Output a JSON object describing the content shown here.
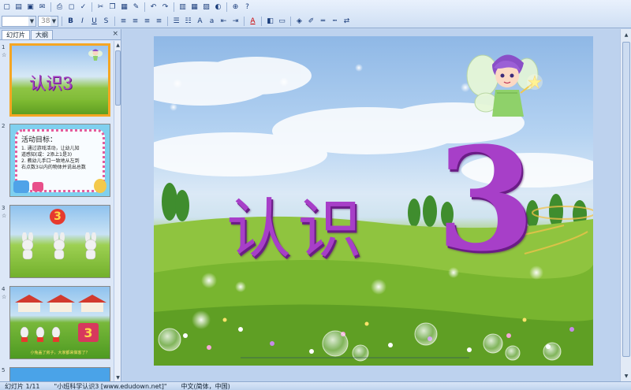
{
  "toolbar": {
    "font_size_value": "38+",
    "font_name_value": "",
    "bold_label": "B",
    "italic_label": "I",
    "underline_label": "U",
    "shadow_label": "S",
    "text_color_label": "A"
  },
  "left_panel": {
    "tabs": [
      {
        "label": "幻灯片"
      },
      {
        "label": "大纲"
      }
    ],
    "close_label": "×",
    "slides": [
      {
        "number": "1",
        "title": "认识3"
      },
      {
        "number": "2",
        "heading": "活动目标：",
        "lines": [
          "1. 通过游戏活动，让幼儿知",
          "道感知(或：2添上1是3)",
          "2. 教幼儿手口一致地从左到",
          "右点数3以内的物体并说出总数"
        ]
      },
      {
        "number": "3",
        "badge": "3"
      },
      {
        "number": "4",
        "badge": "3",
        "caption": "小兔盖了房子，大家都来做客了？"
      },
      {
        "number": "5"
      }
    ]
  },
  "slide": {
    "title_chars": [
      "认",
      "识"
    ],
    "numeral": "3"
  },
  "status_bar": {
    "slide_counter": "幻灯片 1/11",
    "template": "\"小班科学认识3 [www.edudown.net]\"",
    "language": "中文(简体，中国)"
  },
  "colors": {
    "title_purple": "#a73fc8",
    "selection_orange": "#f5a623",
    "badge_red": "#e63a2e"
  }
}
